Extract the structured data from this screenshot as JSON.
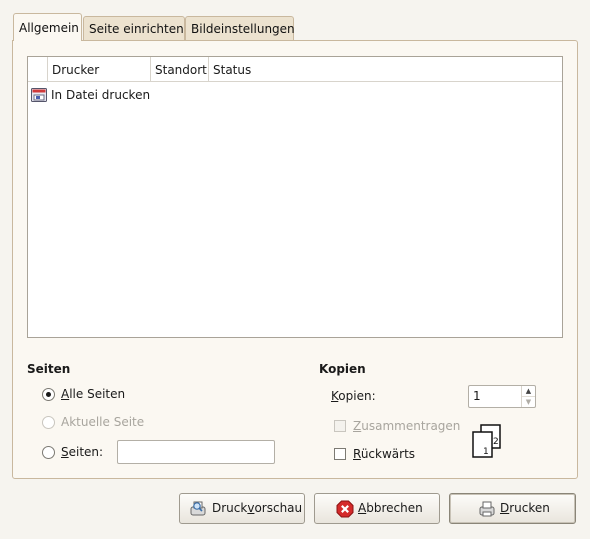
{
  "tabs": [
    {
      "label": "Allgemein",
      "active": true
    },
    {
      "label": "Seite einrichten",
      "active": false
    },
    {
      "label": "Bildeinstellungen",
      "active": false
    }
  ],
  "printer_list": {
    "columns": [
      "Drucker",
      "Standort",
      "Status"
    ],
    "rows": [
      {
        "name": "In Datei drucken",
        "location": "",
        "status": "",
        "icon": "file-printer-icon"
      }
    ]
  },
  "pages": {
    "title": "Seiten",
    "all_pages": {
      "prefix": "",
      "mnemonic": "A",
      "rest": "lle Seiten",
      "checked": true
    },
    "current_page": {
      "label": "Aktuelle Seite",
      "enabled": false
    },
    "range": {
      "mnemonic": "S",
      "rest": "eiten:",
      "value": ""
    }
  },
  "copies": {
    "title": "Kopien",
    "count_label_mnemonic": "K",
    "count_label_rest": "opien:",
    "count": "1",
    "collate": {
      "mnemonic": "Z",
      "rest": "usammentragen",
      "checked": false,
      "enabled": false
    },
    "reverse": {
      "mnemonic": "R",
      "rest": "ückwärts",
      "checked": false
    },
    "collate_graphic": {
      "page_front": "1",
      "page_back": "2"
    }
  },
  "buttons": {
    "preview": {
      "prefix": "Druck",
      "mnemonic": "v",
      "rest": "orschau",
      "icon": "print-preview-icon"
    },
    "cancel": {
      "prefix": "",
      "mnemonic": "A",
      "rest": "bbrechen",
      "icon": "cancel-icon"
    },
    "print": {
      "prefix": "",
      "mnemonic": "D",
      "rest": "rucken",
      "icon": "printer-icon"
    }
  }
}
